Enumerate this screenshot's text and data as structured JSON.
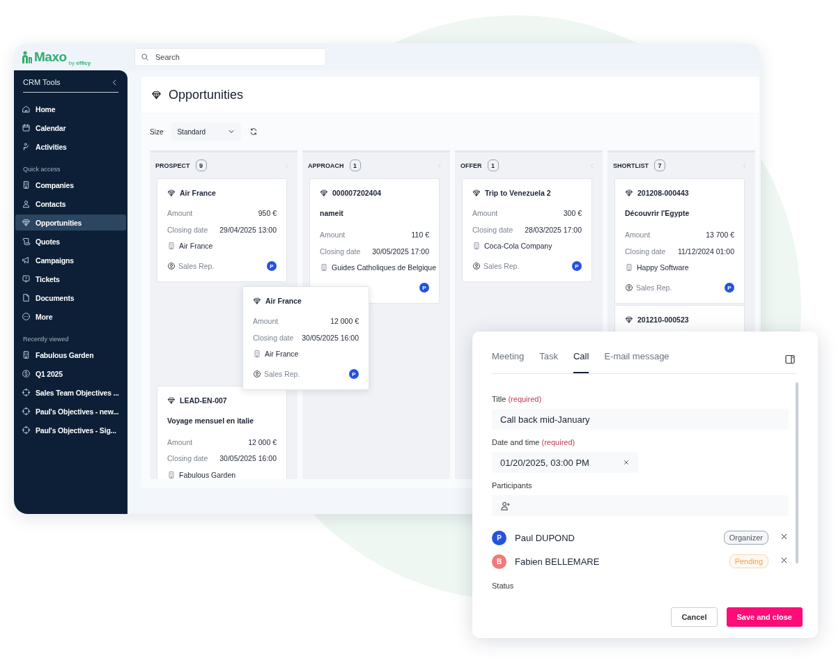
{
  "logo": {
    "name": "Maxo",
    "by": "by",
    "brand": "efficy"
  },
  "search": {
    "placeholder": "Search"
  },
  "sidebar": {
    "title": "CRM Tools",
    "sections": [
      {
        "items": [
          {
            "label": "Home",
            "selected": false
          },
          {
            "label": "Calendar",
            "selected": false
          },
          {
            "label": "Activities",
            "selected": false
          }
        ]
      },
      {
        "heading": "Quick access",
        "items": [
          {
            "label": "Companies",
            "selected": false
          },
          {
            "label": "Contacts",
            "selected": false
          },
          {
            "label": "Opportunities",
            "selected": true
          },
          {
            "label": "Quotes",
            "selected": false
          },
          {
            "label": "Campaigns",
            "selected": false
          },
          {
            "label": "Tickets",
            "selected": false
          },
          {
            "label": "Documents",
            "selected": false
          },
          {
            "label": "More",
            "selected": false
          }
        ]
      },
      {
        "heading": "Recently viewed",
        "items": [
          {
            "label": "Fabulous Garden",
            "selected": false
          },
          {
            "label": "Q1 2025",
            "selected": false
          },
          {
            "label": "Sales Team Objectives ...",
            "selected": false
          },
          {
            "label": "Paul's Objectives - new...",
            "selected": false
          },
          {
            "label": "Paul's Objectives - Sig...",
            "selected": false
          }
        ]
      }
    ]
  },
  "page": {
    "title": "Opportunities"
  },
  "toolbar": {
    "size_label": "Size",
    "size_value": "Standard"
  },
  "columns": [
    {
      "name": "PROSPECT",
      "count": "9",
      "cards": [
        {
          "kind": "card",
          "title": "Air France",
          "fields": [
            {
              "label": "Amount",
              "value": "950 €"
            },
            {
              "label": "Closing date",
              "value": "29/04/2025 13:00"
            }
          ],
          "company": "Air France",
          "owner": "Sales Rep.",
          "avatar": "P"
        },
        {
          "kind": "slot"
        },
        {
          "kind": "card",
          "title": "LEAD-EN-007",
          "subtitle": "Voyage mensuel en italie",
          "fields": [
            {
              "label": "Amount",
              "value": "12 000 €"
            },
            {
              "label": "Closing date",
              "value": "30/05/2025 16:00"
            }
          ],
          "company": "Fabulous Garden"
        }
      ]
    },
    {
      "name": "APPROACH",
      "count": "1",
      "cards": [
        {
          "kind": "card",
          "title": "000007202404",
          "subtitle": "nameit",
          "fields": [
            {
              "label": "Amount",
              "value": "110 €"
            },
            {
              "label": "Closing date",
              "value": "30/05/2025 17:00"
            }
          ],
          "company": "Guides Catholiques de Belgique",
          "avatar": "P"
        }
      ]
    },
    {
      "name": "OFFER",
      "count": "1",
      "cards": [
        {
          "kind": "card",
          "title": "Trip to Venezuela 2",
          "fields": [
            {
              "label": "Amount",
              "value": "300 €"
            },
            {
              "label": "Closing date",
              "value": "28/03/2025 17:00"
            }
          ],
          "company": "Coca-Cola Company",
          "owner": "Sales Rep.",
          "avatar": "P"
        }
      ]
    },
    {
      "name": "SHORTLIST",
      "count": "7",
      "cards": [
        {
          "kind": "card",
          "title": "201208-000443",
          "subtitle": "Découvrir l'Egypte",
          "fields": [
            {
              "label": "Amount",
              "value": "13 700 €"
            },
            {
              "label": "Closing date",
              "value": "11/12/2024 01:00"
            }
          ],
          "company": "Happy Software",
          "owner": "Sales Rep.",
          "avatar": "P"
        },
        {
          "kind": "card",
          "title": "201210-000523"
        }
      ]
    }
  ],
  "dragged_card": {
    "kind": "card",
    "title": "Air France",
    "fields": [
      {
        "label": "Amount",
        "value": "12 000 €"
      },
      {
        "label": "Closing date",
        "value": "30/05/2025 16:00"
      }
    ],
    "company": "Air France",
    "owner": "Sales Rep.",
    "avatar": "P"
  },
  "dialog": {
    "tabs": [
      {
        "label": "Meeting",
        "selected": false
      },
      {
        "label": "Task",
        "selected": false
      },
      {
        "label": "Call",
        "selected": true
      },
      {
        "label": "E-mail message",
        "selected": false
      }
    ],
    "title_field": {
      "label": "Title",
      "note": "(required)",
      "value": "Call back mid-January"
    },
    "date_field": {
      "label": "Date and time",
      "note": "(required)",
      "value": "01/20/2025, 03:00 PM"
    },
    "participants": {
      "label": "Participants",
      "people": [
        {
          "initial": "P",
          "name": "Paul DUPOND",
          "color": "#2553dc",
          "role": "Organizer",
          "kind": "organizer"
        },
        {
          "initial": "B",
          "name": "Fabien BELLEMARE",
          "color": "#f07a7a",
          "role": "Pending",
          "kind": "pending"
        }
      ]
    },
    "status": {
      "label": "Status"
    },
    "buttons": {
      "cancel": "Cancel",
      "save": "Save and close"
    }
  }
}
